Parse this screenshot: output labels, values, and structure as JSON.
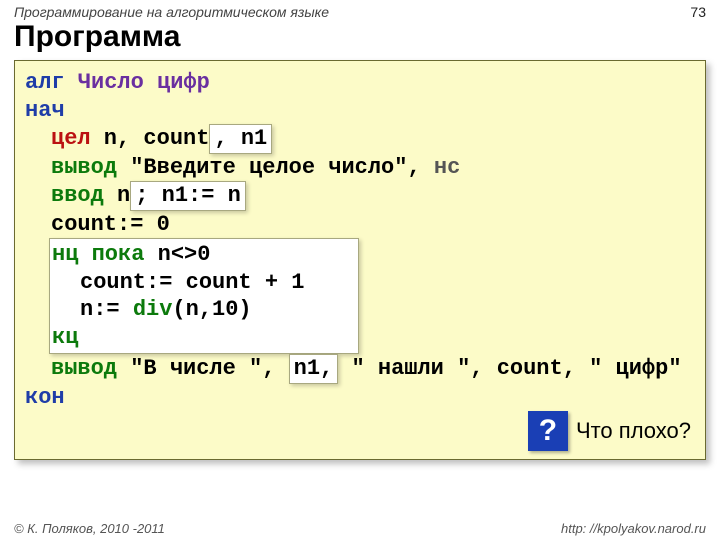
{
  "header": {
    "topic": "Программирование на алгоритмическом языке",
    "page": "73"
  },
  "title": "Программа",
  "code": {
    "l1a": "алг ",
    "l1b": "Число цифр",
    "l2": "нач",
    "l3a": "цел",
    "l3b": " n, count",
    "l3c": ", n1",
    "l4a": "вывод",
    "l4b": " \"Введите целое число\", ",
    "l4c": "нс",
    "l5a": "ввод",
    "l5b": " n",
    "l5c": "; n1:= n",
    "l6": "count:= 0",
    "l7a": "нц пока",
    "l7b": " n<>0",
    "l8": "count:= count + 1",
    "l9a": "n:= ",
    "l9b": "div",
    "l9c": "(n,10)",
    "l10": "кц",
    "l11a": "вывод",
    "l11b": " \"В числе \", ",
    "l11c": "n1,",
    "l11d": " \" нашли \", count, \" цифр\"",
    "l12": "кон"
  },
  "question": {
    "mark": "?",
    "text": "Что плохо?"
  },
  "footer": {
    "left": "© К. Поляков, 2010 -2011",
    "right": "http: //kpolyakov.narod.ru"
  }
}
